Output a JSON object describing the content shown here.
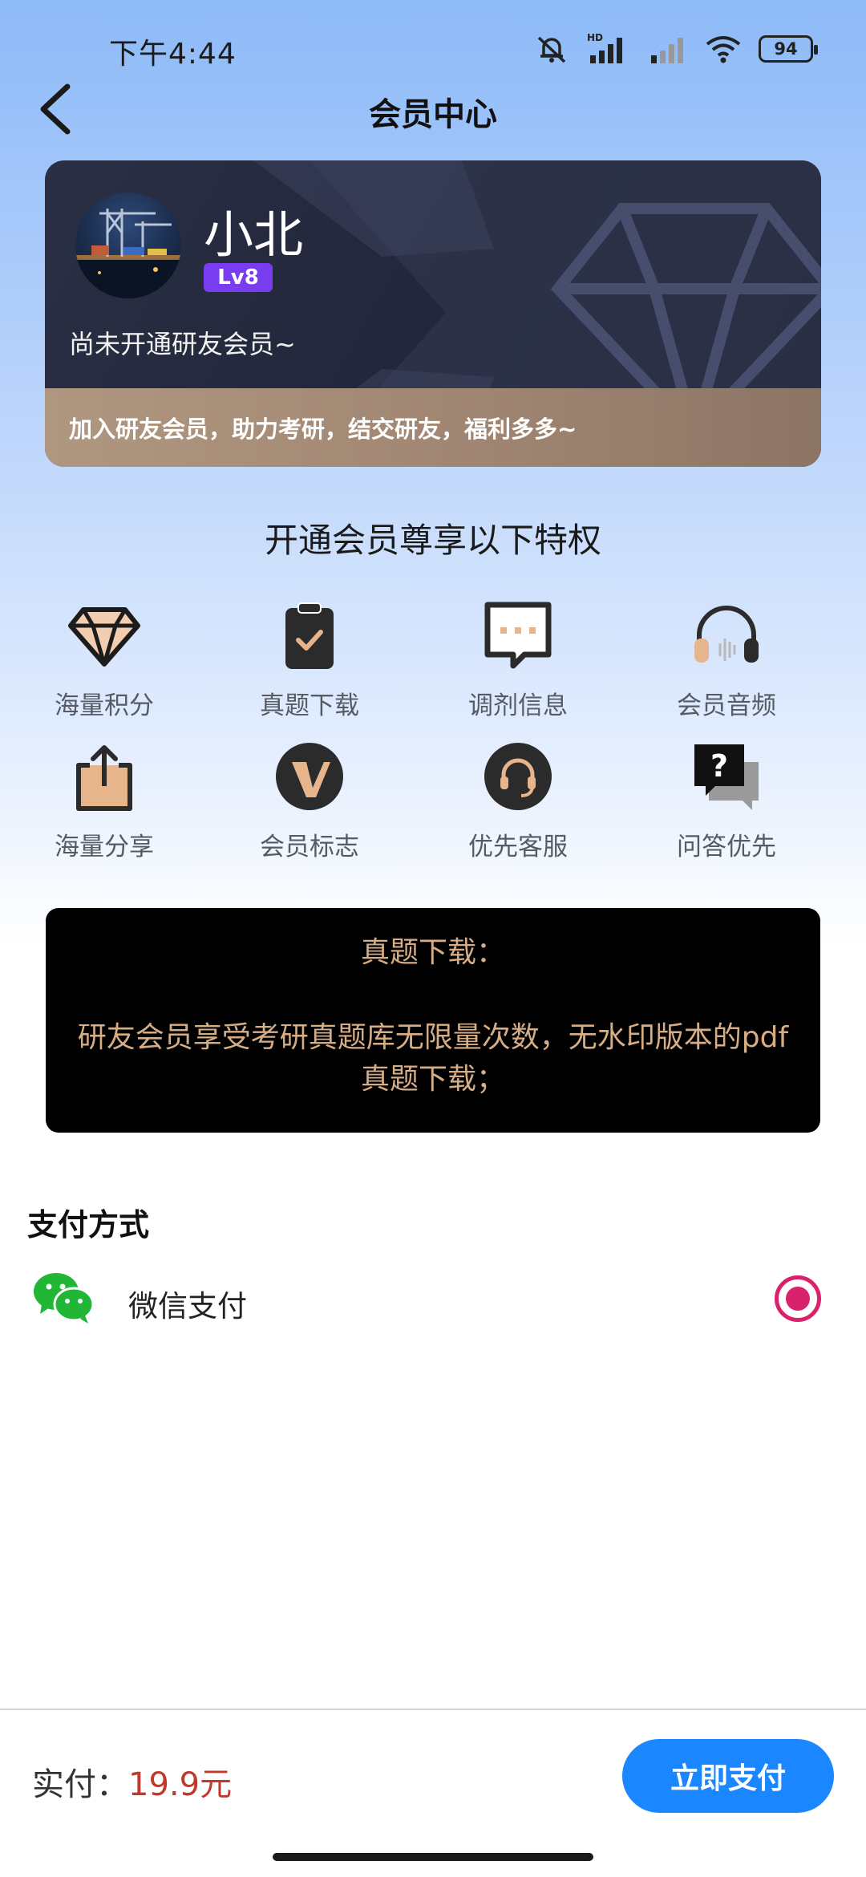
{
  "status_bar": {
    "time": "下午4:44",
    "battery": "94",
    "network_label": "HD"
  },
  "header": {
    "title": "会员中心"
  },
  "member_card": {
    "user_name": "小北",
    "level": "Lv8",
    "status": "尚未开通研友会员~",
    "slogan": "加入研友会员，助力考研，结交研友，福利多多~"
  },
  "privileges": {
    "title": "开通会员尊享以下特权",
    "items": [
      {
        "label": "海量积分",
        "icon": "diamond-icon"
      },
      {
        "label": "真题下载",
        "icon": "clipboard-check-icon"
      },
      {
        "label": "调剂信息",
        "icon": "message-dots-icon"
      },
      {
        "label": "会员音频",
        "icon": "headphones-icon"
      },
      {
        "label": "海量分享",
        "icon": "share-box-icon"
      },
      {
        "label": "会员标志",
        "icon": "v-badge-icon"
      },
      {
        "label": "优先客服",
        "icon": "headset-icon"
      },
      {
        "label": "问答优先",
        "icon": "question-bubble-icon"
      }
    ]
  },
  "detail": {
    "title": "真题下载：",
    "description": "研友会员享受考研真题库无限量次数，无水印版本的pdf真题下载；"
  },
  "payment": {
    "heading": "支付方式",
    "method": "微信支付",
    "selected": true
  },
  "checkout": {
    "label": "实付：",
    "amount": "19.9元",
    "button": "立即支付"
  },
  "colors": {
    "accent_blue": "#1a86ff",
    "price_red": "#c0392b",
    "radio_pink": "#d8226b",
    "gold_text": "#d7ad86",
    "level_purple": "#7a3cf0"
  }
}
